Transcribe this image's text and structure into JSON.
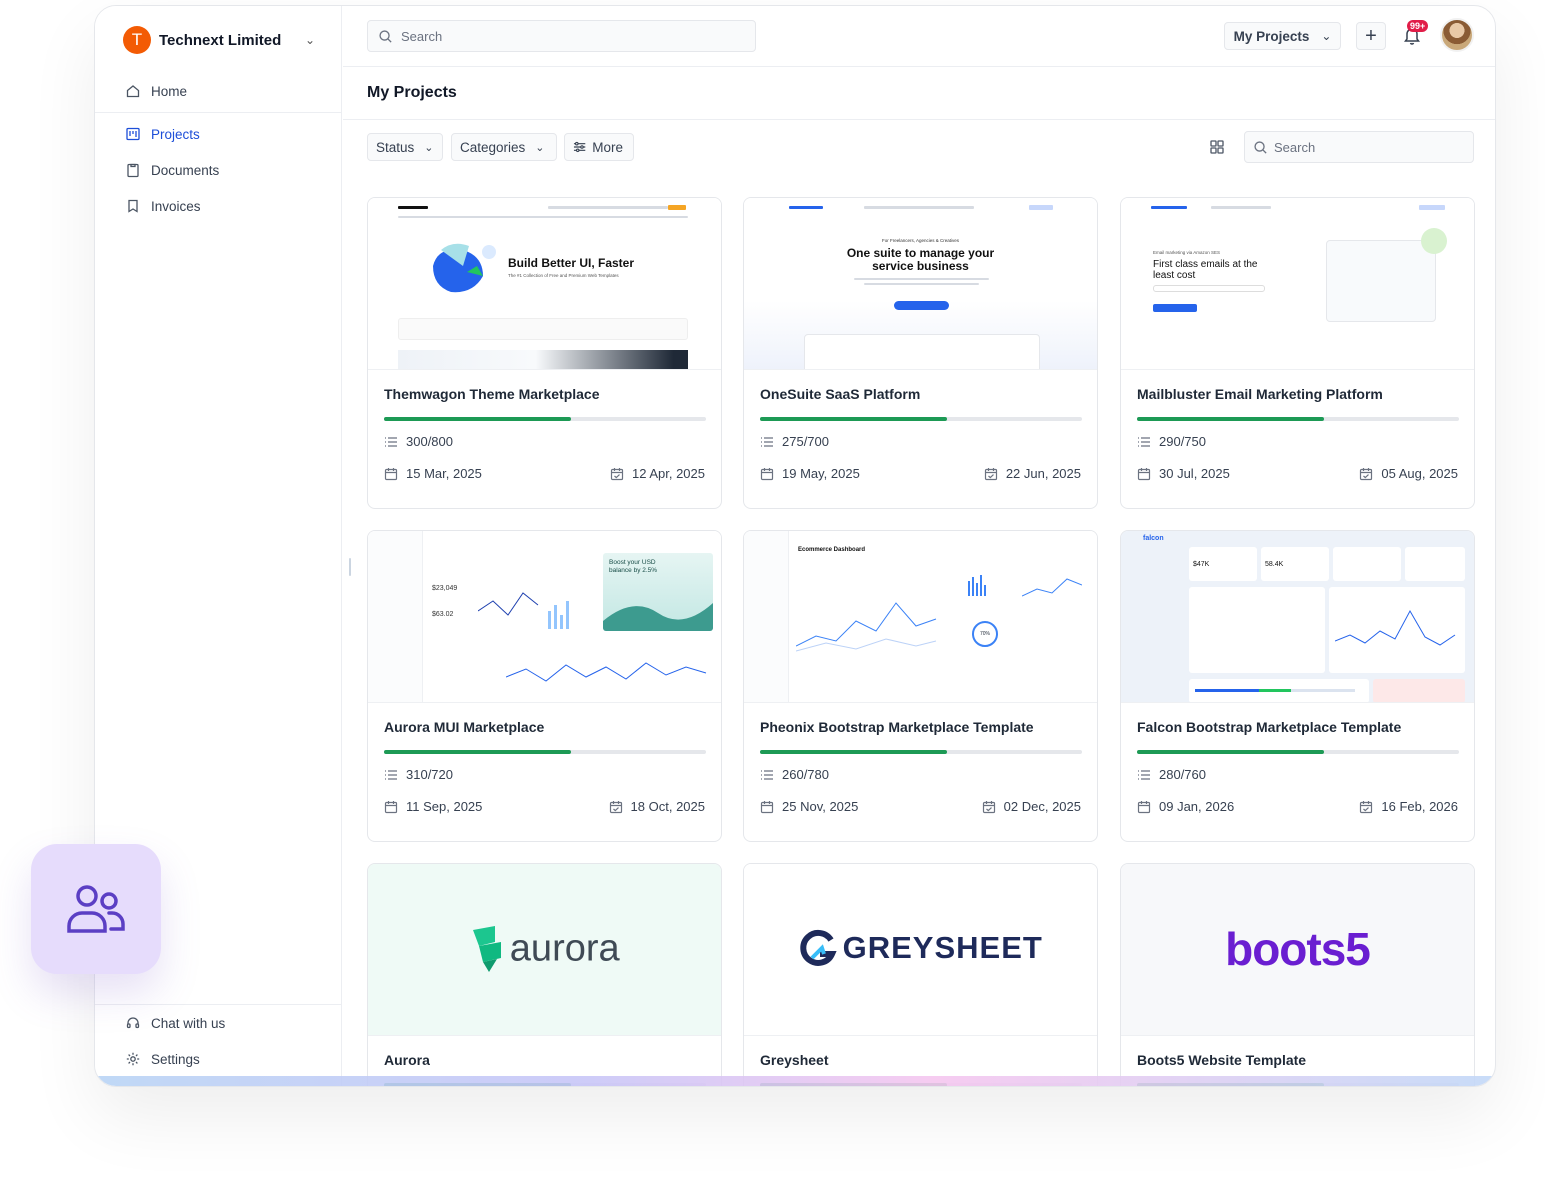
{
  "org": {
    "initial": "T",
    "name": "Technext Limited"
  },
  "nav": {
    "home": "Home",
    "projects": "Projects",
    "documents": "Documents",
    "invoices": "Invoices",
    "chat": "Chat with us",
    "settings": "Settings"
  },
  "topbar": {
    "search_placeholder": "Search",
    "projects_dropdown": "My Projects",
    "notifications_badge": "99+"
  },
  "page": {
    "title": "My Projects"
  },
  "filters": {
    "status": "Status",
    "categories": "Categories",
    "more": "More",
    "search_placeholder": "Search"
  },
  "projects": [
    {
      "title": "Themwagon Theme Marketplace",
      "tasks": "300/800",
      "start": "15 Mar, 2025",
      "end": "12 Apr, 2025",
      "progress": 0.58,
      "hero": "Build Better UI, Faster",
      "hero_sub": "The #1 Collection of Free and Premium Web Templates"
    },
    {
      "title": "OneSuite SaaS Platform",
      "tasks": "275/700",
      "start": "19 May, 2025",
      "end": "22 Jun, 2025",
      "progress": 0.58,
      "kicker": "For Freelancers, Agencies & Creatives",
      "hero": "One suite to manage your service business"
    },
    {
      "title": "Mailbluster Email Marketing Platform",
      "tasks": "290/750",
      "start": "30 Jul, 2025",
      "end": "05 Aug, 2025",
      "progress": 0.58,
      "kicker": "Email marketing via Amazon SES",
      "hero": "First class emails at the least cost"
    },
    {
      "title": "Aurora MUI Marketplace",
      "tasks": "310/720",
      "start": "11 Sep, 2025",
      "end": "18 Oct, 2025",
      "progress": 0.58,
      "stat1": "$23,049",
      "stat2": "$63.02",
      "promo": "Boost your USD balance by 2.5%"
    },
    {
      "title": "Pheonix Bootstrap Marketplace Template",
      "tasks": "260/780",
      "start": "25 Nov, 2025",
      "end": "02 Dec, 2025",
      "progress": 0.58,
      "dash": "Ecommerce Dashboard",
      "pct": "70%"
    },
    {
      "title": "Falcon Bootstrap Marketplace Template",
      "tasks": "280/760",
      "start": "09 Jan, 2026",
      "end": "16 Feb, 2026",
      "progress": 0.58,
      "brand": "falcon",
      "stat1": "$47K",
      "stat2": "58.4K"
    },
    {
      "title": "Aurora",
      "progress": 0.58,
      "logo": "aurora"
    },
    {
      "title": "Greysheet",
      "progress": 0.58,
      "logo": "GREYSHEET"
    },
    {
      "title": "Boots5 Website Template",
      "progress": 0.58,
      "logo": "boots5"
    }
  ],
  "colors": {
    "accent": "#1d4ed8",
    "progress": "#1d9a55",
    "org": "#f35b04",
    "badge": "#e11d48"
  }
}
